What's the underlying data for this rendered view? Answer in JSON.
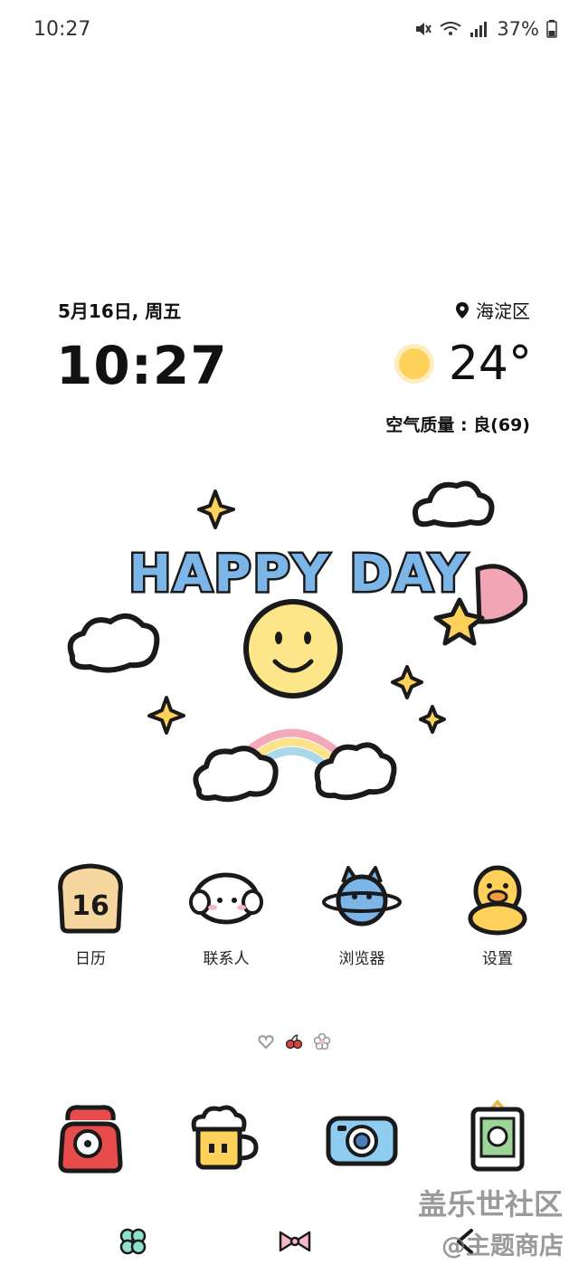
{
  "status_bar": {
    "time": "10:27",
    "battery": "37%",
    "icons": [
      "mute-icon",
      "wifi-icon",
      "signal-icon",
      "battery-icon"
    ]
  },
  "widget": {
    "date": "5月16日, 周五",
    "time": "10:27",
    "location": "海淀区",
    "temperature": "24°",
    "air_quality": "空气质量 : 良(69)",
    "weather_icon": "sun-icon"
  },
  "hero": {
    "text": "HAPPY DAY"
  },
  "apps": [
    {
      "label": "日历",
      "icon": "toast-calendar-icon",
      "day": "16"
    },
    {
      "label": "联系人",
      "icon": "puppy-icon"
    },
    {
      "label": "浏览器",
      "icon": "cat-planet-icon"
    },
    {
      "label": "设置",
      "icon": "duck-icon"
    }
  ],
  "page_indicator": [
    "heart-dot",
    "cherry-dot",
    "flower-dot"
  ],
  "dock": [
    "telephone-icon",
    "beer-icon",
    "camera-icon",
    "photo-frame-icon"
  ],
  "nav_bar": [
    "clover-icon",
    "bow-icon",
    "back-icon"
  ],
  "watermark": {
    "line1": "盖乐世社区",
    "line2": "@主题商店"
  },
  "colors": {
    "sun_yellow": "#FDD15A",
    "outline": "#1a1a1a"
  }
}
